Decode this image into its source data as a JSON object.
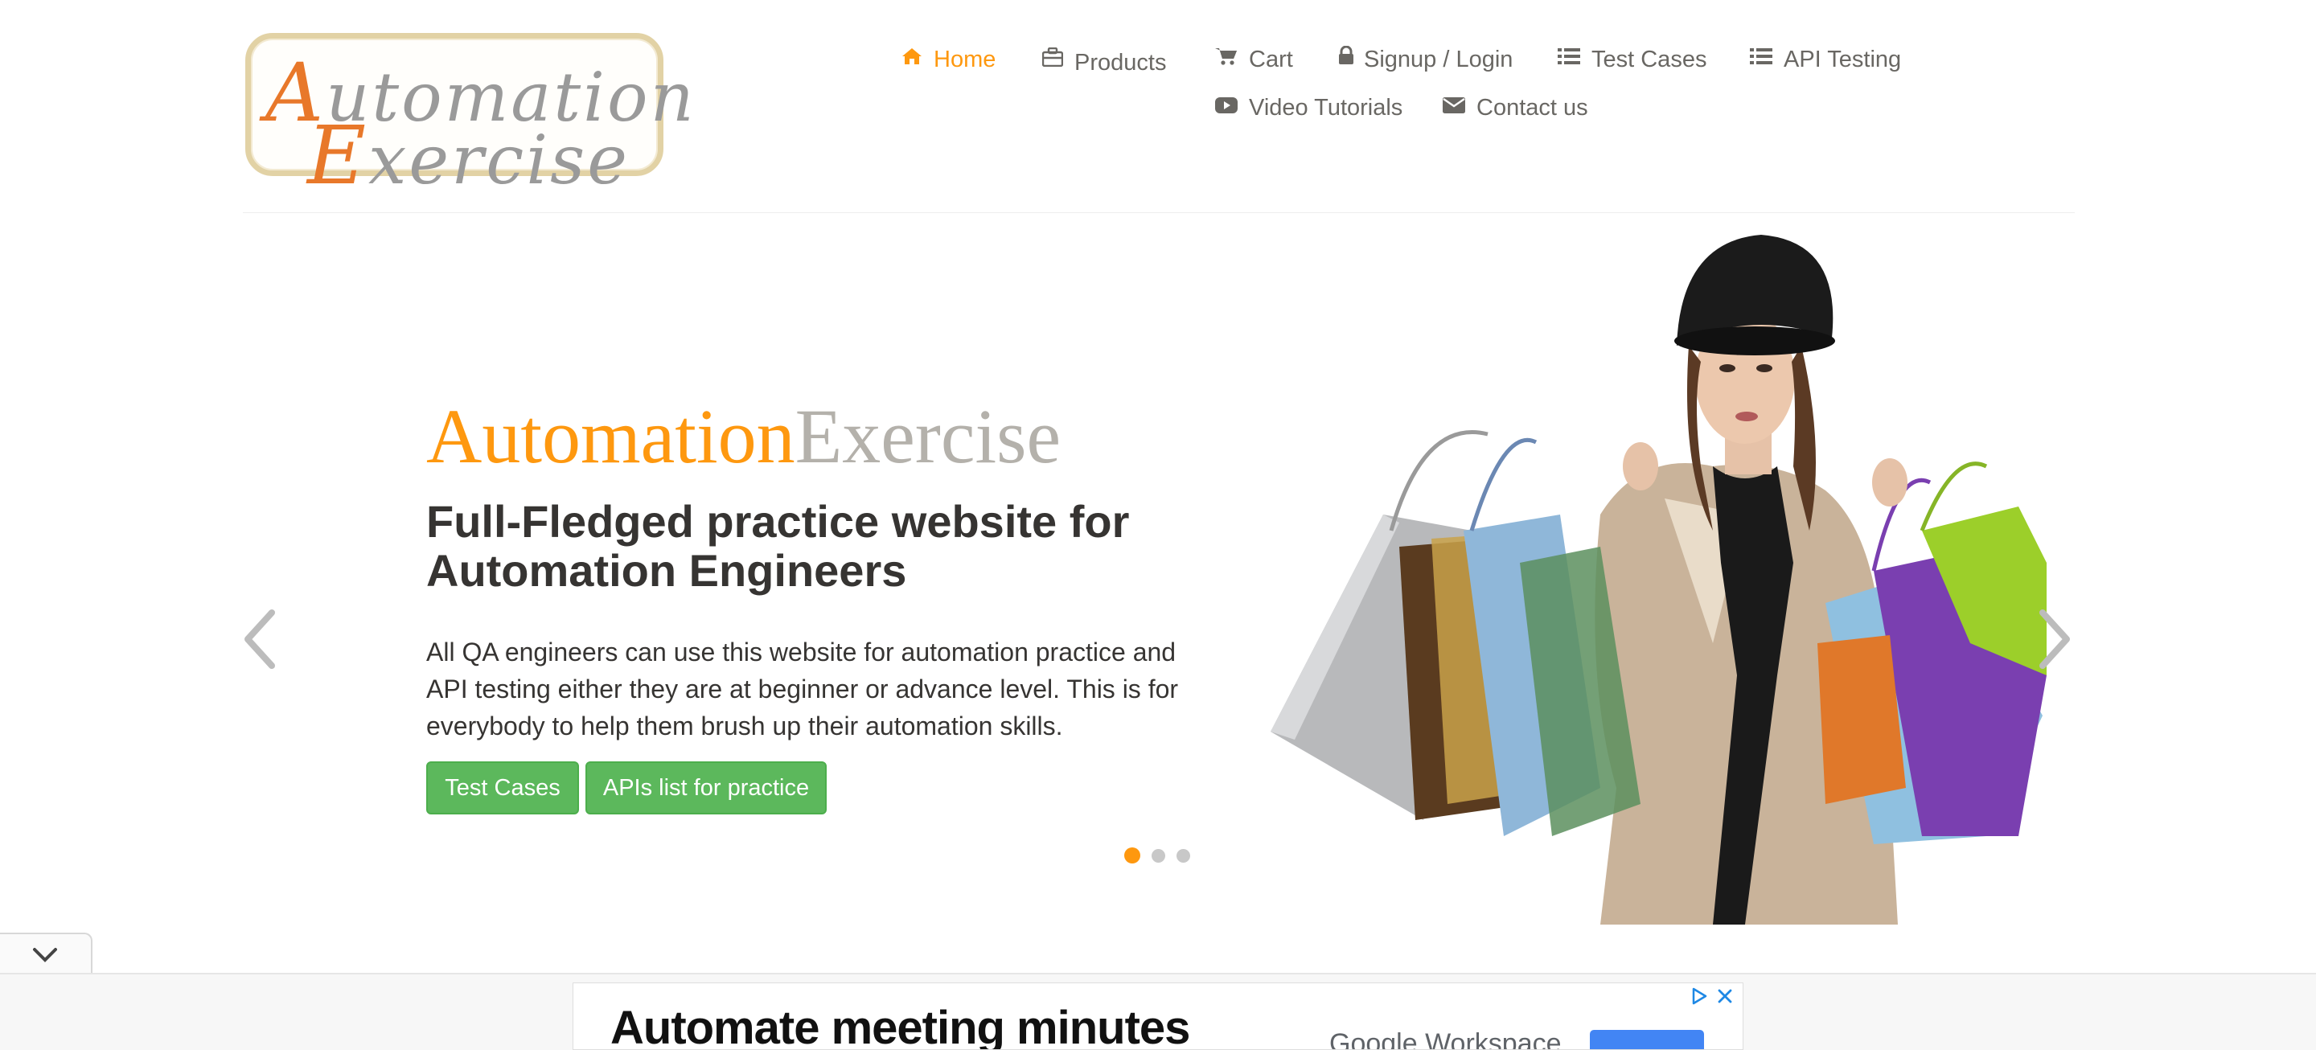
{
  "header": {
    "logo": {
      "line1": "Automation",
      "line2": "Exercise"
    },
    "nav": [
      {
        "label": "Home",
        "icon": "home-icon",
        "active": true
      },
      {
        "label": "Products",
        "icon": "briefcase-icon"
      },
      {
        "label": "Cart",
        "icon": "shopping-cart-icon"
      },
      {
        "label": "Signup / Login",
        "icon": "lock-icon"
      },
      {
        "label": "Test Cases",
        "icon": "list-icon"
      },
      {
        "label": "API Testing",
        "icon": "list-icon"
      },
      {
        "label": "Video Tutorials",
        "icon": "youtube-play-icon"
      },
      {
        "label": "Contact us",
        "icon": "envelope-icon"
      }
    ]
  },
  "slider": {
    "brand_part1": "Automation",
    "brand_part2": "Exercise",
    "headline": "Full-Fledged practice website for Automation Engineers",
    "description": "All QA engineers can use this website for automation practice and API testing either they are at beginner or advance level. This is for everybody to help them brush up their automation skills.",
    "buttons": {
      "test_cases": "Test Cases",
      "apis_list": "APIs list for practice"
    },
    "indicators": {
      "count": 3,
      "active_index": 0
    },
    "hero_image": "girl-with-shopping-bags"
  },
  "ad": {
    "title": "Automate meeting minutes",
    "brand": "Google Workspace",
    "icons": [
      "adchoices-icon",
      "close-icon"
    ]
  },
  "colors": {
    "accent": "#FE980F",
    "text_dark": "#363432",
    "text_nav": "#696763",
    "button_green": "#5CB85C",
    "brand_gray": "#B4B1AB"
  }
}
